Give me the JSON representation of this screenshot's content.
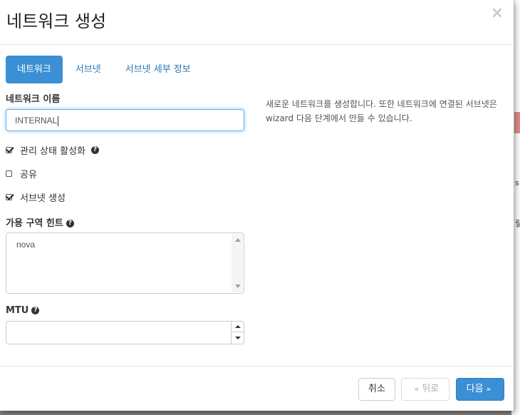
{
  "dialog": {
    "title": "네트워크 생성",
    "close_glyph": "×"
  },
  "tabs": [
    {
      "label": "네트워크",
      "active": true
    },
    {
      "label": "서브넷",
      "active": false
    },
    {
      "label": "서브넷 세부 정보",
      "active": false
    }
  ],
  "form": {
    "network_name": {
      "label": "네트워크 이름",
      "value": "INTERNAL"
    },
    "admin_state": {
      "label": "관리 상태 활성화",
      "checked": true
    },
    "shared": {
      "label": "공유",
      "checked": false
    },
    "create_subnet": {
      "label": "서브넷 생성",
      "checked": true
    },
    "az_hints": {
      "label": "가용 구역 힌트",
      "options": [
        "nova"
      ]
    },
    "mtu": {
      "label": "MTU",
      "value": ""
    }
  },
  "help_text": "새로운 네트워크를 생성합니다. 또한 네트워크에 연결된 서브넷은 wizard 다음 단계에서 만들 수 있습니다.",
  "footer": {
    "cancel_label": "취소",
    "back_label": "뒤로",
    "back_chevron": "«",
    "next_label": "다음",
    "next_chevron": "»"
  },
  "background_text": {
    "fragment_1": "s",
    "fragment_2": "릴"
  },
  "colors": {
    "primary": "#3b8fd4",
    "link": "#2a7ab8",
    "focus_border": "#66afe9"
  }
}
